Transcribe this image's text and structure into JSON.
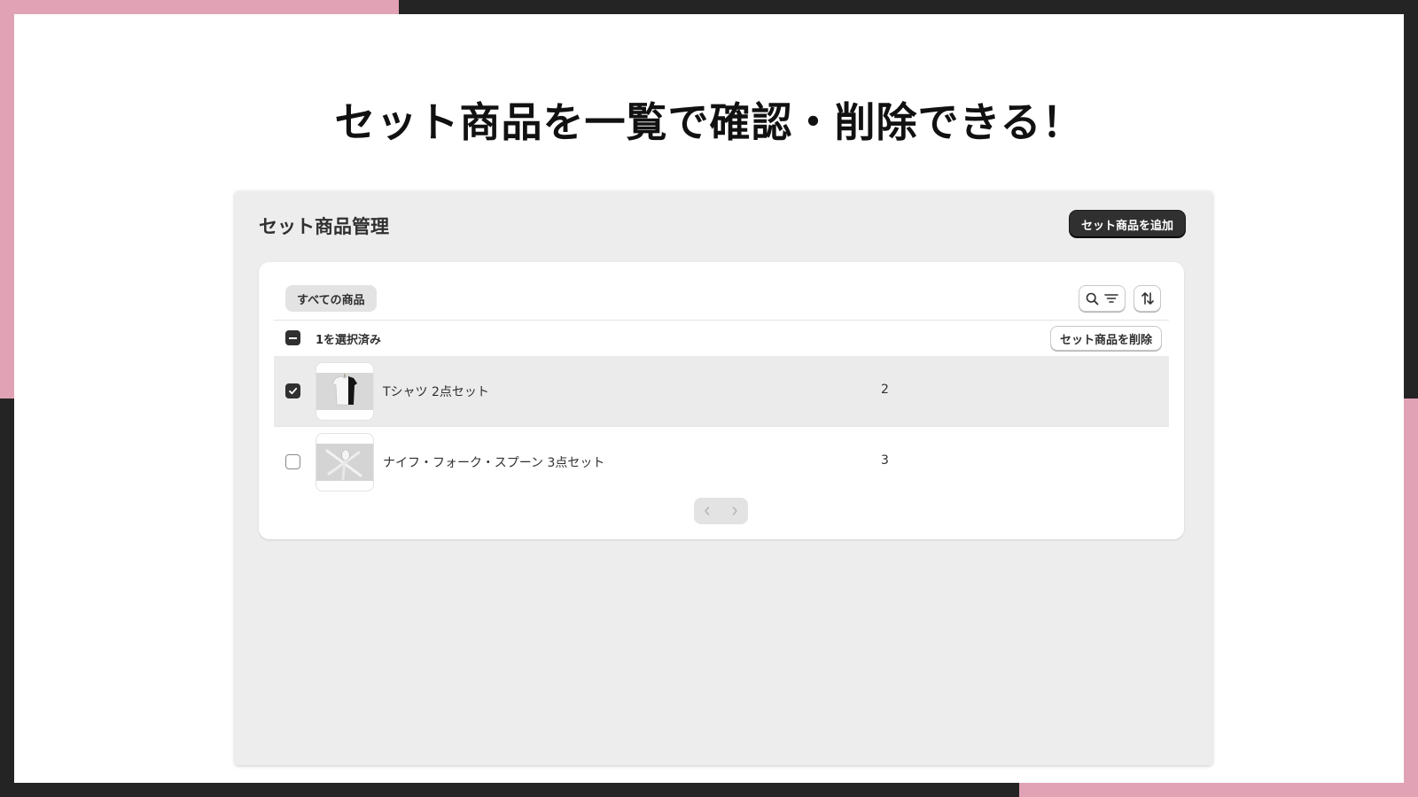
{
  "headline": "セット商品を一覧で確認・削除できる！",
  "page": {
    "title": "セット商品管理",
    "add_button_label": "セット商品を追加"
  },
  "filter_bar": {
    "tabs": [
      {
        "label": "すべての商品",
        "selected": true
      }
    ],
    "icons": [
      "search-icon",
      "filter-icon",
      "sort-icon"
    ]
  },
  "bulk_actions": {
    "selected_label": "1を選択済み",
    "delete_button_label": "セット商品を削除"
  },
  "table": {
    "rows": [
      {
        "name": "Tシャツ 2点セット",
        "count": "2",
        "checked": true,
        "thumbnail": "tshirt-image"
      },
      {
        "name": "ナイフ・フォーク・スプーン 3点セット",
        "count": "3",
        "checked": false,
        "thumbnail": "cutlery-image"
      }
    ]
  },
  "pagination": {
    "prev_enabled": false,
    "next_enabled": false
  },
  "colors": {
    "accent_pink": "#e0a2b4",
    "frame_dark": "#242424",
    "primary_button": "#303030"
  }
}
